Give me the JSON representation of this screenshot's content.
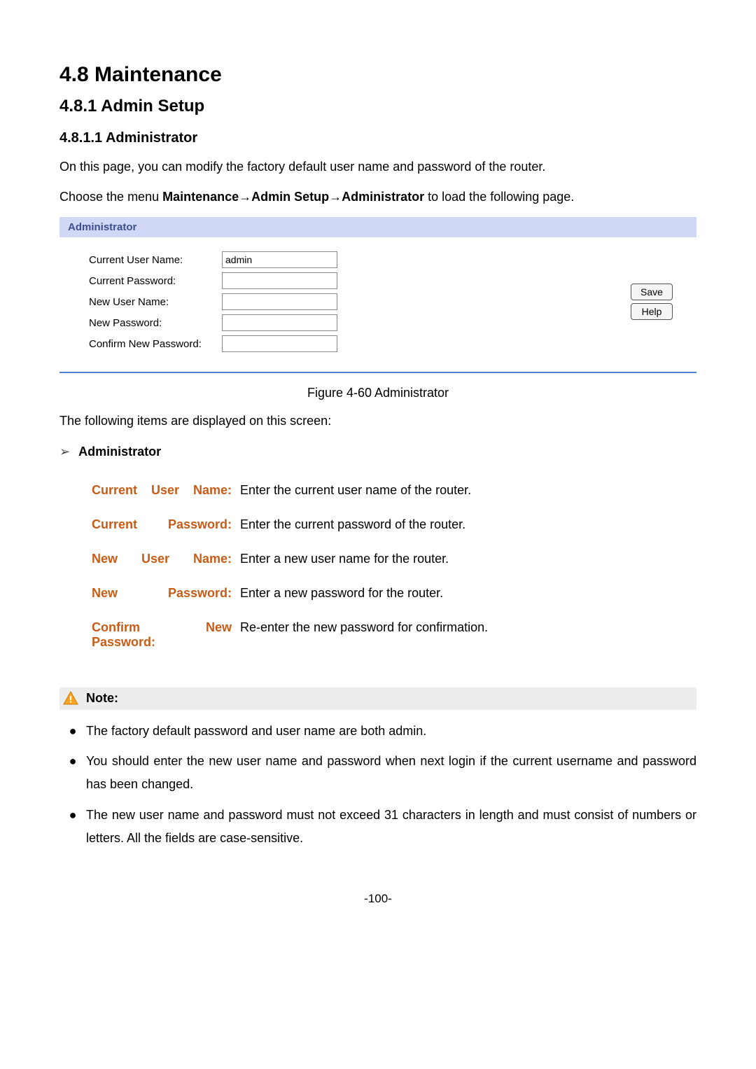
{
  "headings": {
    "h1": "4.8  Maintenance",
    "h2": "4.8.1  Admin Setup",
    "h3": "4.8.1.1   Administrator"
  },
  "intro": "On this page, you can modify the factory default user name and password of the router.",
  "menu_sentence": {
    "prefix": "Choose the menu ",
    "bold": "Maintenance→Admin Setup→Administrator",
    "suffix": " to load the following page."
  },
  "panel": {
    "title": "Administrator",
    "fields": {
      "current_user_label": "Current User Name:",
      "current_user_value": "admin",
      "current_pass_label": "Current Password:",
      "new_user_label": "New User Name:",
      "new_pass_label": "New Password:",
      "confirm_pass_label": "Confirm New Password:"
    },
    "buttons": {
      "save": "Save",
      "help": "Help"
    }
  },
  "figure_caption": "Figure 4-60 Administrator",
  "followup": "The following items are displayed on this screen:",
  "def_heading": "Administrator",
  "definitions": [
    {
      "label": "Current User Name:",
      "desc": "Enter the current user name of the router."
    },
    {
      "label": "Current Password:",
      "desc": "Enter the current password of the router."
    },
    {
      "label": "New User Name:",
      "desc": "Enter a new user name for the router."
    },
    {
      "label": "New Password:",
      "desc": "Enter a new password for the router."
    },
    {
      "label": "Confirm New Password:",
      "desc": "Re-enter the new password for confirmation."
    }
  ],
  "note": {
    "title": "Note:",
    "items": [
      "The factory default password and user name are both admin.",
      "You should enter the new user name and password when next login if the current username and password has been changed.",
      "The new user name and password must not exceed 31 characters in length and must consist of numbers or letters. All the fields are case-sensitive."
    ]
  },
  "page_number": "-100-"
}
